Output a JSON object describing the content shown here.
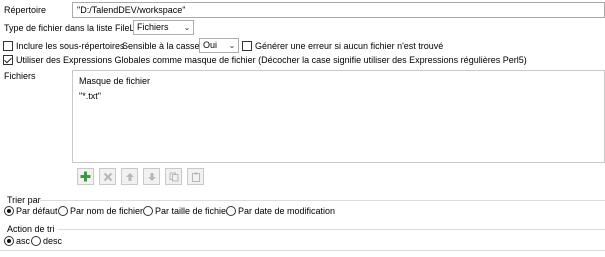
{
  "directory": {
    "label": "Répertoire",
    "value": "\"D:/TalendDEV/workspace\""
  },
  "file_type": {
    "label": "Type de fichier dans la liste FileList",
    "selected": "Fichiers"
  },
  "include_subdirs": {
    "label": "Inclure les sous-répertoires",
    "checked": false
  },
  "case_sensitive": {
    "label": "Sensible à la casse",
    "selected": "Oui"
  },
  "error_if_none": {
    "label": "Générer une erreur si aucun fichier n'est trouvé",
    "checked": false
  },
  "use_glob": {
    "label": "Utiliser des Expressions Globales comme masque de fichier (Décocher la case signifie utiliser des Expressions régulières Perl5)",
    "checked": true
  },
  "files": {
    "label": "Fichiers",
    "column_header": "Masque de fichier",
    "rows": [
      "\"*.txt\""
    ]
  },
  "toolbar": {
    "icons": [
      "add-icon",
      "delete-icon",
      "move-up-icon",
      "move-down-icon",
      "copy-icon",
      "paste-icon"
    ]
  },
  "sort_by": {
    "title": "Trier par",
    "options": [
      "Par défaut",
      "Par nom de fichier",
      "Par taille de fichier",
      "Par date de modification"
    ],
    "selected": "Par défaut"
  },
  "sort_action": {
    "title": "Action de tri",
    "options": [
      "asc",
      "desc"
    ],
    "selected": "asc"
  },
  "colors": {
    "add_green": "#3c9a3c",
    "disabled_icon": "#b8b8b8"
  }
}
